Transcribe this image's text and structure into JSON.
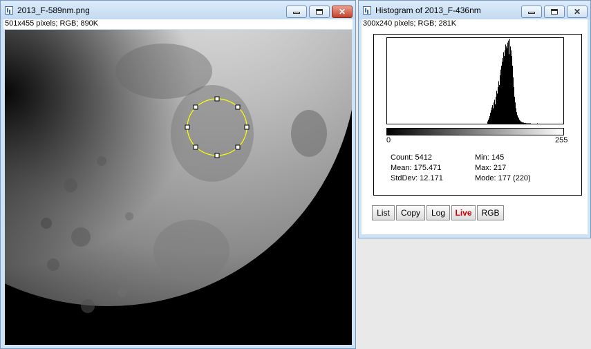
{
  "left_window": {
    "title": "2013_F-589nm.png",
    "info": "501x455 pixels; RGB; 890K",
    "close_glyph": "✕"
  },
  "right_window": {
    "title": "Histogram of 2013_F-436nm",
    "info": "300x240 pixels; RGB; 281K",
    "axis_min": "0",
    "axis_max": "255",
    "stats": {
      "count": "Count: 5412",
      "mean": "Mean: 175.471",
      "stddev": "StdDev: 12.171",
      "min": "Min: 145",
      "max": "Max: 217",
      "mode": "Mode: 177 (220)"
    },
    "buttons": [
      "List",
      "Copy",
      "Log",
      "Live",
      "RGB"
    ],
    "close_glyph": "✕"
  },
  "roi": {
    "shape": "oval",
    "color": "#ffff00"
  },
  "chart_data": {
    "type": "bar",
    "xlim": [
      0,
      255
    ],
    "x": [
      145,
      146,
      147,
      148,
      149,
      150,
      151,
      152,
      153,
      154,
      155,
      156,
      157,
      158,
      159,
      160,
      161,
      162,
      163,
      164,
      165,
      166,
      167,
      168,
      169,
      170,
      171,
      172,
      173,
      174,
      175,
      176,
      177,
      178,
      179,
      180,
      181,
      182,
      183,
      184,
      185,
      186,
      187,
      188,
      189,
      190,
      191,
      192,
      193,
      194,
      195,
      196,
      197,
      198,
      199,
      200,
      201,
      202,
      203,
      204,
      205,
      206,
      207,
      208,
      209,
      210,
      211,
      212,
      213,
      214,
      215,
      216,
      217
    ],
    "values": [
      6,
      10,
      14,
      20,
      28,
      35,
      42,
      48,
      40,
      55,
      62,
      50,
      70,
      85,
      78,
      95,
      110,
      100,
      125,
      140,
      150,
      170,
      160,
      185,
      175,
      190,
      205,
      200,
      195,
      210,
      215,
      180,
      220,
      200,
      190,
      175,
      150,
      120,
      95,
      70,
      55,
      40,
      30,
      22,
      18,
      14,
      10,
      8,
      6,
      5,
      4,
      3,
      3,
      2,
      2,
      2,
      1,
      1,
      1,
      1,
      1,
      1,
      1,
      0,
      0,
      0,
      0,
      0,
      0,
      0,
      0,
      0,
      1
    ]
  }
}
